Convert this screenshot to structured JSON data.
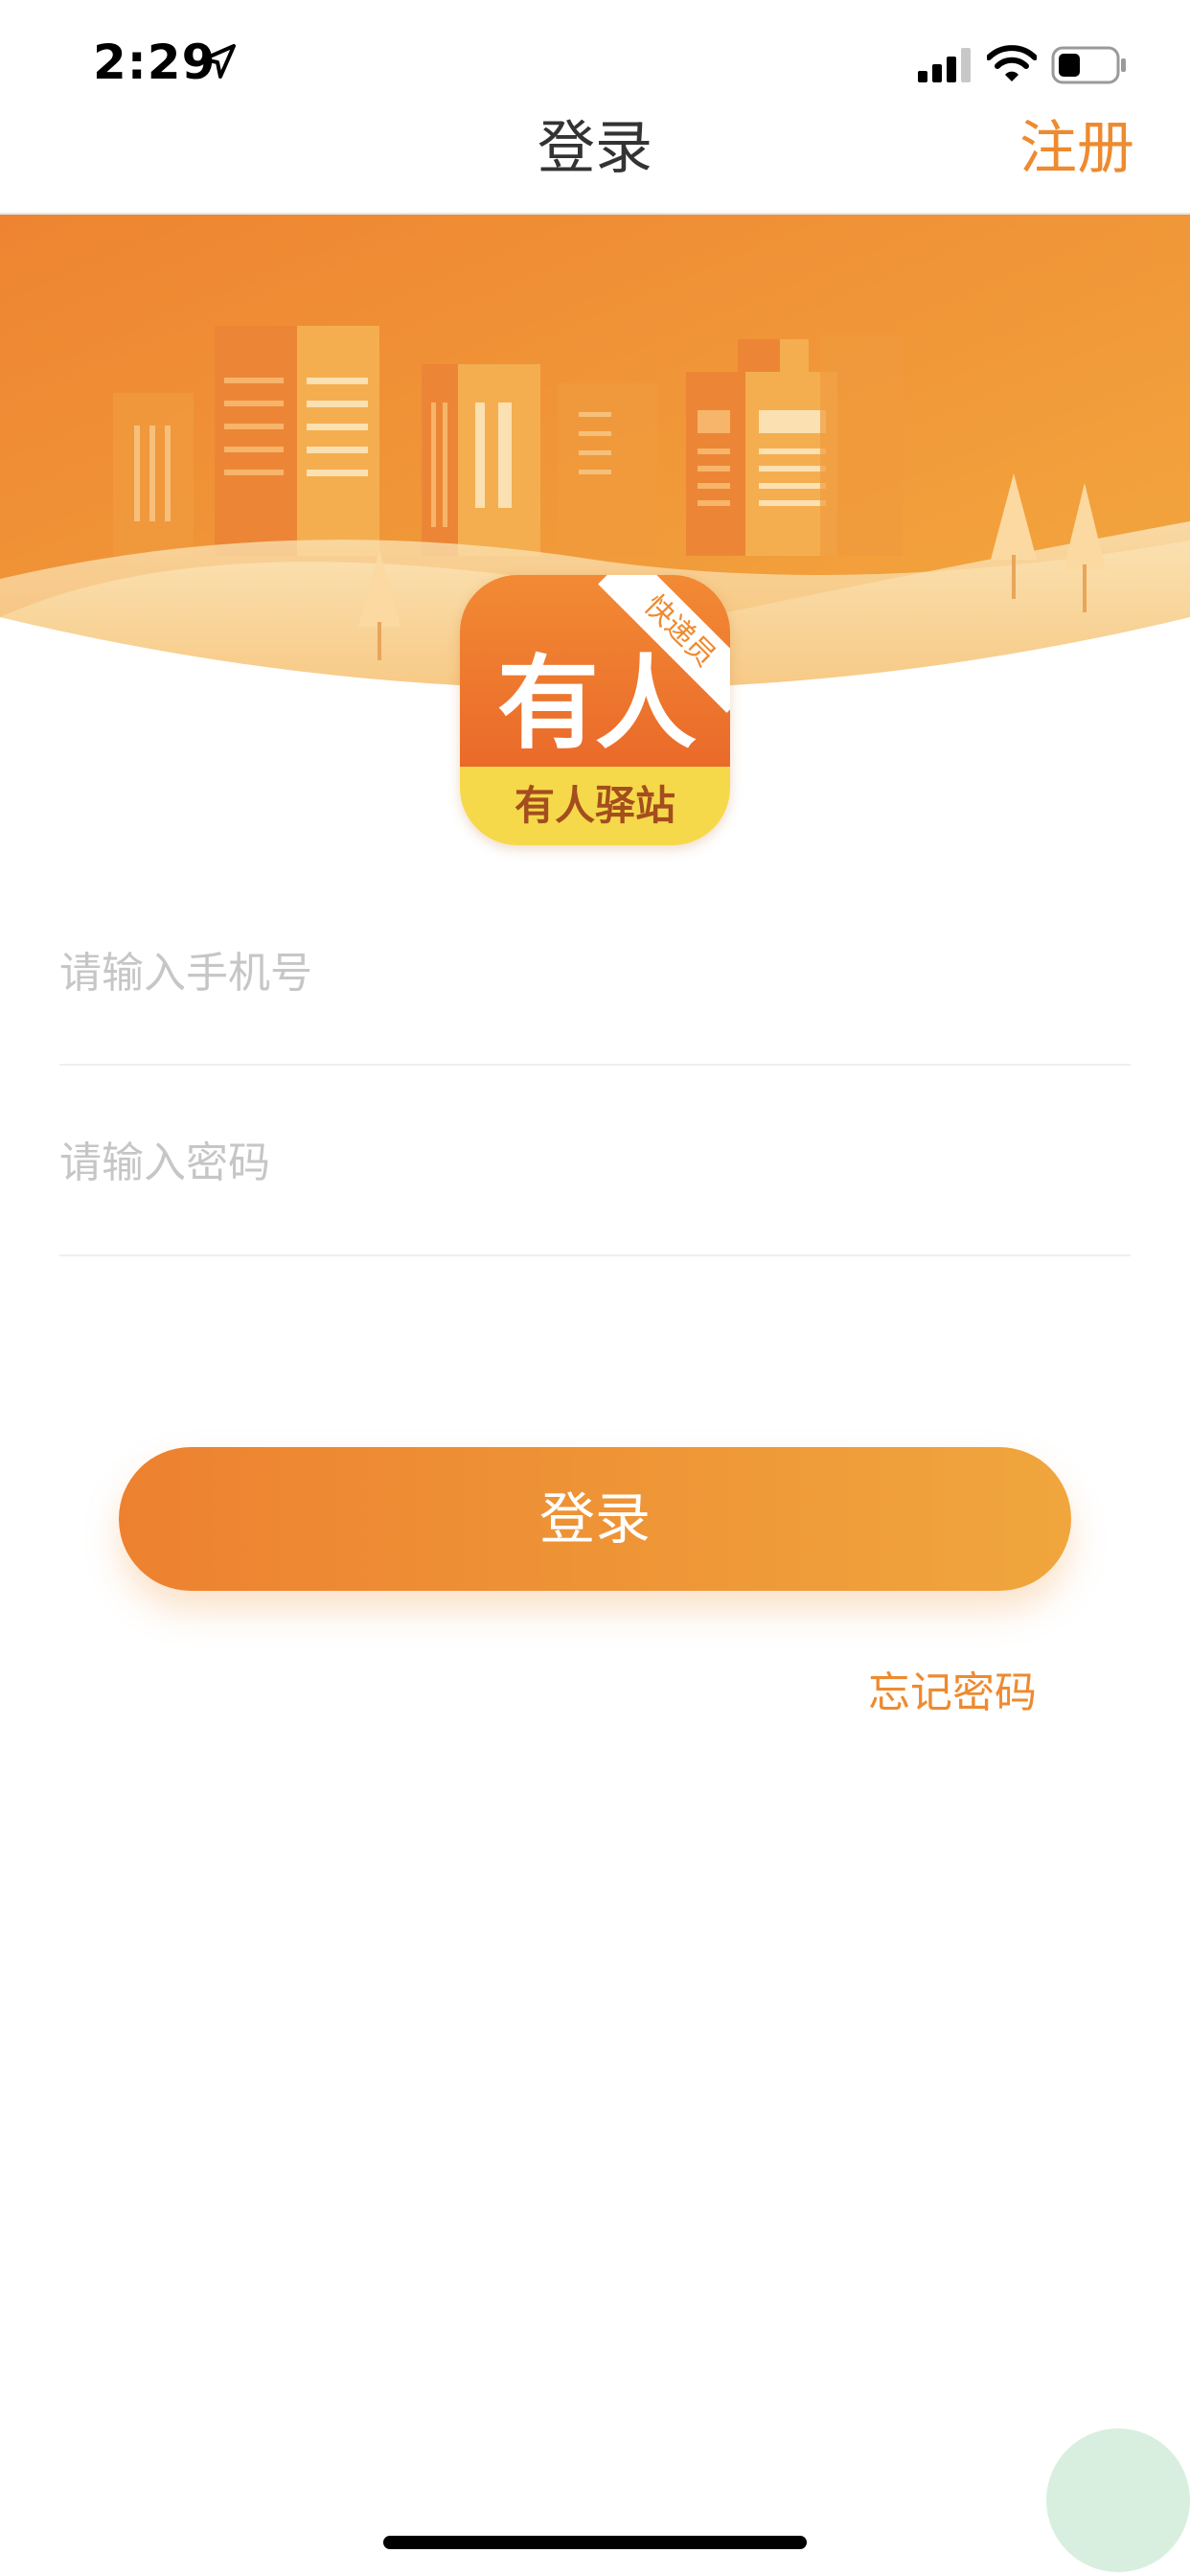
{
  "status_bar": {
    "time": "2:29",
    "icons": [
      "location-arrow-icon",
      "cellular-signal-icon",
      "wifi-icon",
      "battery-icon"
    ]
  },
  "nav": {
    "title": "登录",
    "register_label": "注册"
  },
  "logo": {
    "main_text": "有人",
    "ribbon_text": "快递员",
    "bottom_text": "有人驿站"
  },
  "form": {
    "phone": {
      "placeholder": "请输入手机号",
      "value": ""
    },
    "password": {
      "placeholder": "请输入密码",
      "value": ""
    }
  },
  "login_button_label": "登录",
  "forgot_password_label": "忘记密码",
  "colors": {
    "accent": "#ee8a2f",
    "button_start": "#ed8130",
    "button_end": "#f0a63d",
    "logo_yellow": "#f5d94a"
  }
}
